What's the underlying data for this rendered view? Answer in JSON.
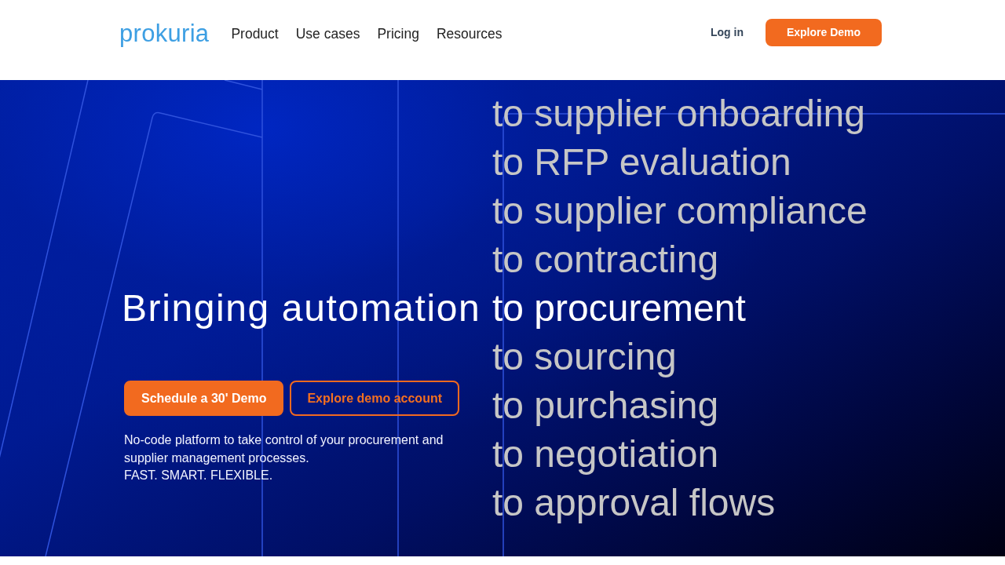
{
  "header": {
    "logo": "prokuria",
    "nav": [
      "Product",
      "Use cases",
      "Pricing",
      "Resources"
    ],
    "login": "Log in",
    "cta": "Explore Demo"
  },
  "hero": {
    "headline": "Bringing automation",
    "phrases": [
      {
        "text": "to supplier onboarding",
        "selected": false
      },
      {
        "text": "to RFP evaluation",
        "selected": false
      },
      {
        "text": "to supplier compliance",
        "selected": false
      },
      {
        "text": "to contracting",
        "selected": false
      },
      {
        "text": "to procurement",
        "selected": true
      },
      {
        "text": "to sourcing",
        "selected": false
      },
      {
        "text": "to purchasing",
        "selected": false
      },
      {
        "text": "to negotiation",
        "selected": false
      },
      {
        "text": "to approval flows",
        "selected": false
      }
    ],
    "buttons": [
      {
        "label": "Schedule a 30' Demo",
        "kind": "filled"
      },
      {
        "label": "Explore demo account",
        "kind": "outline"
      }
    ],
    "description": "No-code platform to take control of your procurement and supplier management processes.",
    "tagline": "FAST. SMART. FLEXIBLE."
  }
}
